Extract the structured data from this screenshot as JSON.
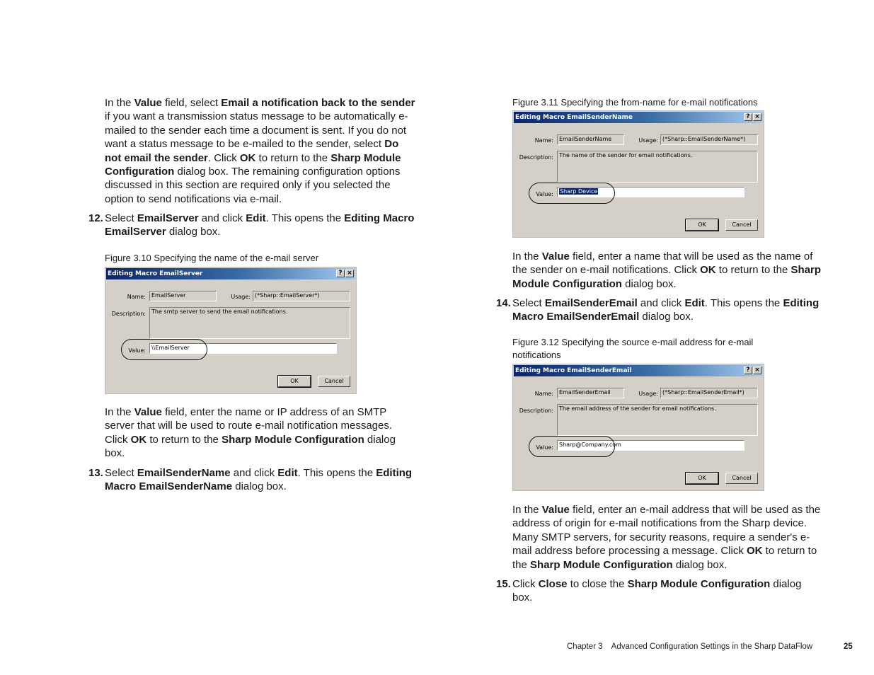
{
  "left_column": {
    "intro_paragraph": [
      {
        "t": "In the ",
        "b": false
      },
      {
        "t": "Value",
        "b": true
      },
      {
        "t": " field, select ",
        "b": false
      },
      {
        "t": "Email a notification back to the sender",
        "b": true
      },
      {
        "t": " if you want a transmission status message to be automatically e-mailed to the sender each time a document is sent. If you do not want a status message to be e-mailed to the sender, select ",
        "b": false
      },
      {
        "t": "Do not email the sender",
        "b": true
      },
      {
        "t": ". Click ",
        "b": false
      },
      {
        "t": "OK",
        "b": true
      },
      {
        "t": " to return to the ",
        "b": false
      },
      {
        "t": "Sharp Module Configuration",
        "b": true
      },
      {
        "t": " dialog box. The remaining configuration options discussed in this section are required only if you selected the option to send notifications via e-mail.",
        "b": false
      }
    ],
    "step12": {
      "number": "12.",
      "text": [
        {
          "t": "Select ",
          "b": false
        },
        {
          "t": "EmailServer",
          "b": true
        },
        {
          "t": " and click ",
          "b": false
        },
        {
          "t": "Edit",
          "b": true
        },
        {
          "t": ". This opens the ",
          "b": false
        },
        {
          "t": "Editing Macro EmailServer",
          "b": true
        },
        {
          "t": " dialog box.",
          "b": false
        }
      ]
    },
    "figure_3_10": {
      "caption": "Figure 3.10  Specifying the name of the e-mail server",
      "dialog": {
        "title": "Editing Macro EmailServer",
        "help_button": "?",
        "close_button": "×",
        "name_label": "Name:",
        "name_value": "EmailServer",
        "usage_label": "Usage:",
        "usage_value": "(*Sharp::EmailServer*)",
        "description_label": "Description:",
        "description_value": "The smtp server to send the email notifications.",
        "value_label": "Value:",
        "value_value": "\\\\EmailServer",
        "ok_label": "OK",
        "cancel_label": "Cancel"
      }
    },
    "after_fig_paragraph": [
      {
        "t": "In the ",
        "b": false
      },
      {
        "t": "Value",
        "b": true
      },
      {
        "t": " field, enter the name or IP address of an SMTP server that will be used to route e-mail notification messages. Click ",
        "b": false
      },
      {
        "t": "OK",
        "b": true
      },
      {
        "t": " to return to the ",
        "b": false
      },
      {
        "t": "Sharp Module Configuration",
        "b": true
      },
      {
        "t": " dialog box.",
        "b": false
      }
    ],
    "step13": {
      "number": "13.",
      "text": [
        {
          "t": "Select ",
          "b": false
        },
        {
          "t": "EmailSenderName",
          "b": true
        },
        {
          "t": " and click ",
          "b": false
        },
        {
          "t": "Edit",
          "b": true
        },
        {
          "t": ". This opens the ",
          "b": false
        },
        {
          "t": "Editing Macro EmailSenderName",
          "b": true
        },
        {
          "t": " dialog box.",
          "b": false
        }
      ]
    }
  },
  "right_column": {
    "figure_3_11": {
      "caption": "Figure 3.11  Specifying the from-name for e-mail notifications",
      "dialog": {
        "title": "Editing Macro EmailSenderName",
        "help_button": "?",
        "close_button": "×",
        "name_label": "Name:",
        "name_value": "EmailSenderName",
        "usage_label": "Usage:",
        "usage_value": "(*Sharp::EmailSenderName*)",
        "description_label": "Description:",
        "description_value": "The name of the sender for email notifications.",
        "value_label": "Value:",
        "value_value": "Sharp Device",
        "ok_label": "OK",
        "cancel_label": "Cancel"
      }
    },
    "after_fig11_paragraph": [
      {
        "t": "In the ",
        "b": false
      },
      {
        "t": "Value",
        "b": true
      },
      {
        "t": " field, enter a name that will be used as the name of the sender on e-mail notifications. Click ",
        "b": false
      },
      {
        "t": "OK",
        "b": true
      },
      {
        "t": " to return to the ",
        "b": false
      },
      {
        "t": "Sharp Module Configuration",
        "b": true
      },
      {
        "t": " dialog box.",
        "b": false
      }
    ],
    "step14": {
      "number": "14.",
      "text": [
        {
          "t": "Select ",
          "b": false
        },
        {
          "t": "EmailSenderEmail",
          "b": true
        },
        {
          "t": " and click ",
          "b": false
        },
        {
          "t": "Edit",
          "b": true
        },
        {
          "t": ". This opens the ",
          "b": false
        },
        {
          "t": "Editing Macro EmailSenderEmail",
          "b": true
        },
        {
          "t": " dialog box.",
          "b": false
        }
      ]
    },
    "figure_3_12": {
      "caption": "Figure 3.12  Specifying the source e-mail address for e-mail notifications",
      "dialog": {
        "title": "Editing Macro EmailSenderEmail",
        "help_button": "?",
        "close_button": "×",
        "name_label": "Name:",
        "name_value": "EmailSenderEmail",
        "usage_label": "Usage:",
        "usage_value": "(*Sharp::EmailSenderEmail*)",
        "description_label": "Description:",
        "description_value": "The email address of the sender for email notifications.",
        "value_label": "Value:",
        "value_value": "Sharp@Company.com",
        "ok_label": "OK",
        "cancel_label": "Cancel"
      }
    },
    "after_fig12_paragraph": [
      {
        "t": "In the ",
        "b": false
      },
      {
        "t": "Value",
        "b": true
      },
      {
        "t": " field, enter an e-mail address that will be used as the address of origin for e-mail notifications from the Sharp device. Many SMTP servers, for security reasons, require a sender's e-mail address before processing a message. Click ",
        "b": false
      },
      {
        "t": "OK",
        "b": true
      },
      {
        "t": " to return to the ",
        "b": false
      },
      {
        "t": "Sharp Module Configuration",
        "b": true
      },
      {
        "t": " dialog box.",
        "b": false
      }
    ],
    "step15": {
      "number": "15.",
      "text": [
        {
          "t": "Click ",
          "b": false
        },
        {
          "t": "Close",
          "b": true
        },
        {
          "t": " to close the ",
          "b": false
        },
        {
          "t": "Sharp Module Configuration",
          "b": true
        },
        {
          "t": " dialog box.",
          "b": false
        }
      ]
    }
  },
  "footer": {
    "chapter": "Chapter 3    Advanced Configuration Settings in the Sharp DataFlow",
    "page_number": "25"
  }
}
